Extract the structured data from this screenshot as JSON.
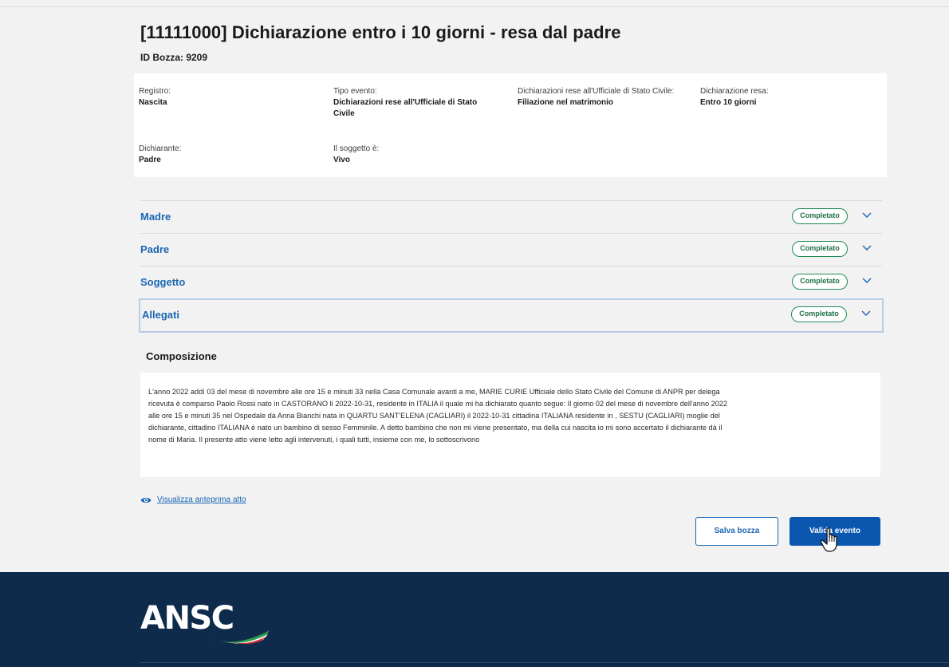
{
  "page": {
    "title": "[11111000] Dichiarazione entro i 10 giorni - resa dal padre",
    "draft_id": "ID Bozza: 9209"
  },
  "summary": {
    "registro_label": "Registro:",
    "registro_value": "Nascita",
    "tipo_label": "Tipo evento:",
    "tipo_value": "Dichiarazioni rese all'Ufficiale di Stato Civile",
    "dich_label": "Dichiarazioni rese all'Ufficiale di Stato Civile:",
    "dich_value": "Filiazione nel matrimonio",
    "resa_label": "Dichiarazione resa:",
    "resa_value": "Entro 10 giorni",
    "dichiarante_label": "Dichiarante:",
    "dichiarante_value": "Padre",
    "soggetto_label": "Il soggetto è:",
    "soggetto_value": "Vivo"
  },
  "sections": [
    {
      "title": "Madre",
      "status": "Completato"
    },
    {
      "title": "Padre",
      "status": "Completato"
    },
    {
      "title": "Soggetto",
      "status": "Completato"
    },
    {
      "title": "Allegati",
      "status": "Completato"
    }
  ],
  "composition": {
    "title": "Composizione",
    "text": "L'anno 2022 addì 03 del mese di novembre alle ore 15 e minuti 33 nella Casa Comunale avanti a me, MARIE CURIE Ufficiale dello Stato Civile del Comune di ANPR per delega ricevuta è comparso Paolo Rossi nato in CASTORANO li 2022-10-31, residente in ITALIA il quale mi ha dichiarato quanto segue: Il giorno 02 del mese di novembre dell'anno 2022 alle ore 15 e minuti 35 nel Ospedale da Anna Bianchi nata in QUARTU SANT'ELENA (CAGLIARI) il 2022-10-31 cittadina ITALIANA residente in , SESTU (CAGLIARI) moglie del dichiarante, cittadino ITALIANA è nato un bambino di sesso Femminile. A detto bambino che non mi viene presentato, ma della cui nascita io mi sono accertato il dichiarante dà il nome di Maria. Il presente atto viene letto agli intervenuti, i quali tutti, insieme con me, lo sottoscrivono"
  },
  "actions": {
    "preview_label": "Visualizza anteprima atto",
    "save_label": "Salva bozza",
    "validate_label": "Valida evento"
  },
  "footer": {
    "logo_text": "ANSC"
  },
  "colors": {
    "primary": "#0b57b0",
    "link": "#1a66b3",
    "success": "#1f8a56",
    "footer_bg": "#0f2b4c"
  }
}
